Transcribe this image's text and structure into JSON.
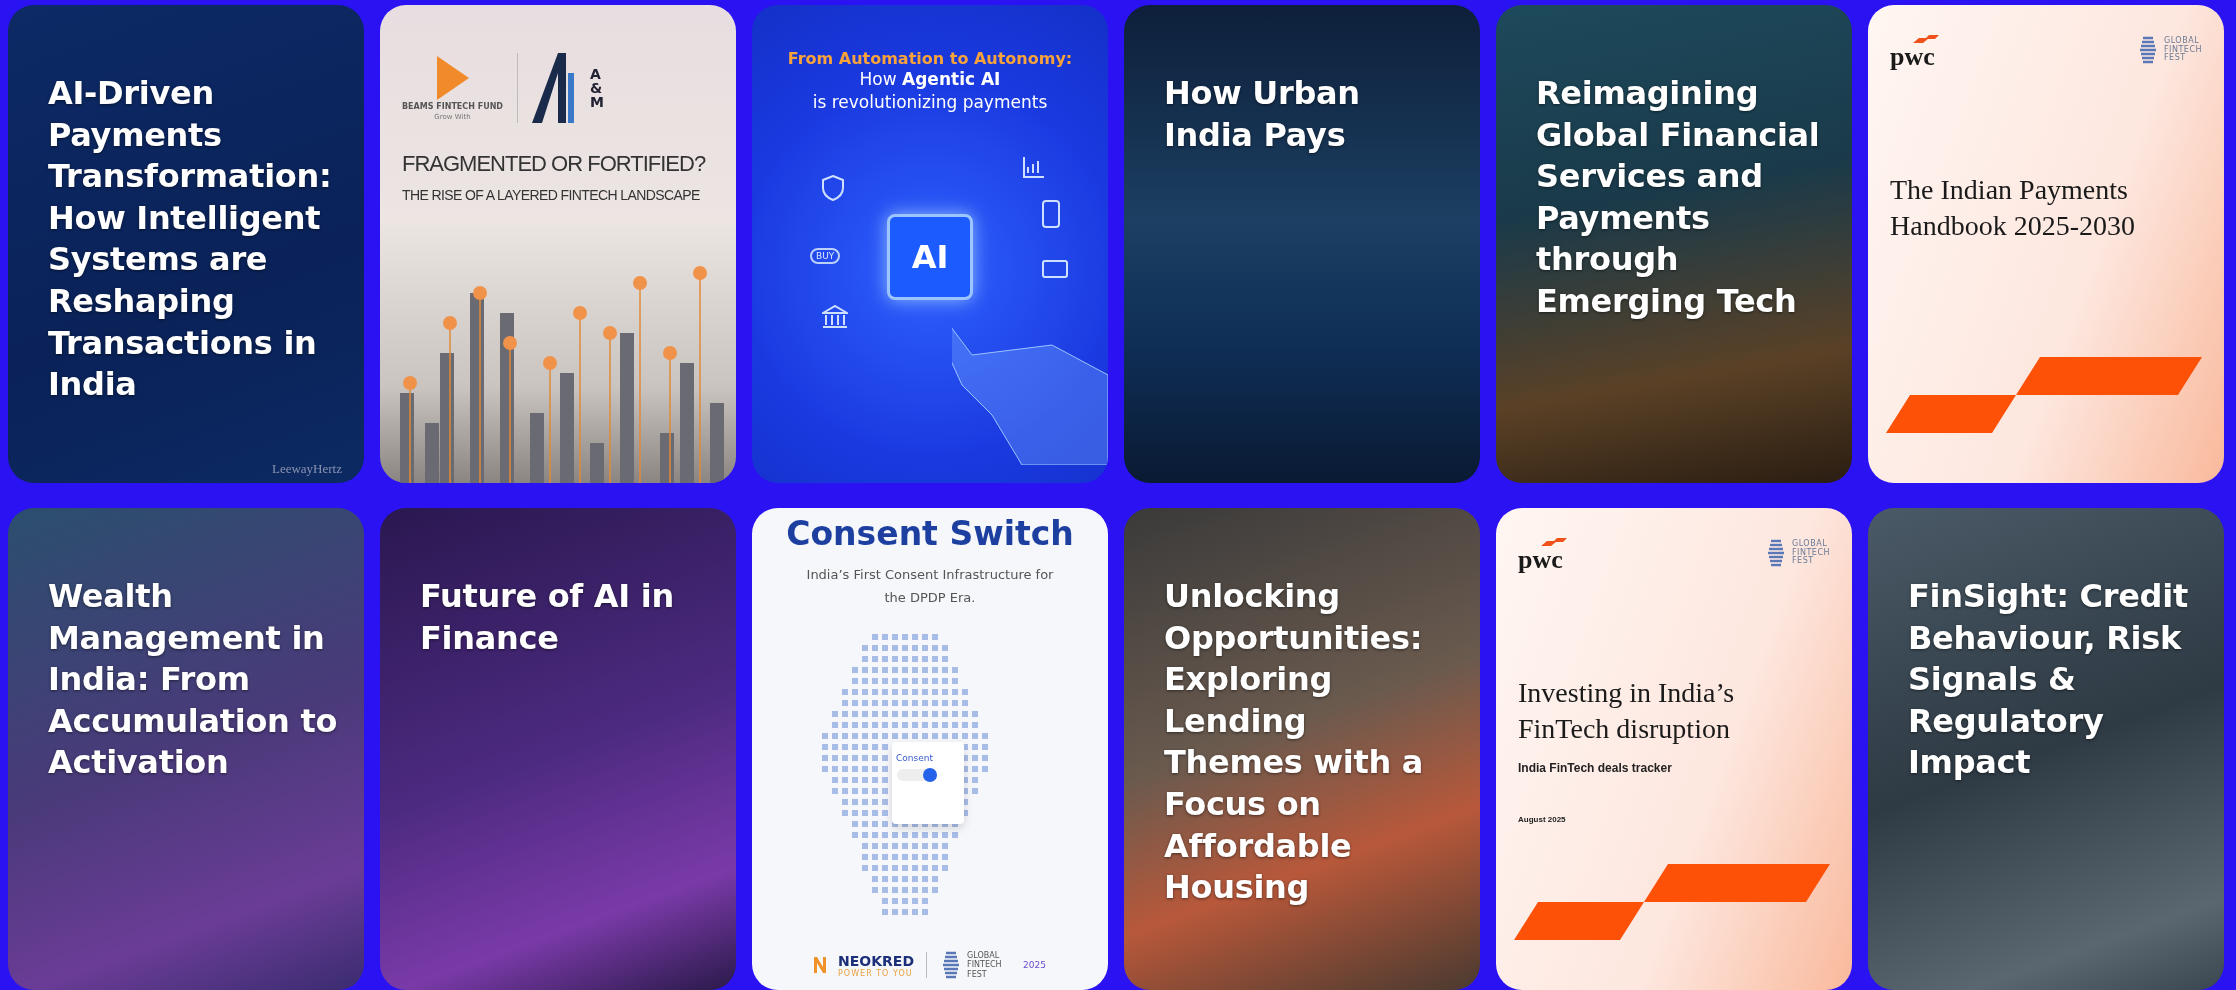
{
  "cards": [
    {
      "kind": "overlay",
      "title": "AI-Driven Payments Transformation: How Intelligent Systems are Reshaping Transactions in India",
      "credit": "LeewayHertz"
    },
    {
      "kind": "landscape",
      "fund": "BEAMS FINTECH FUND",
      "tagline": "Grow With",
      "partner": "A&M",
      "title": "FRAGMENTED OR FORTIFIED?",
      "subtitle": "THE RISE OF A LAYERED FINTECH LANDSCAPE"
    },
    {
      "kind": "agentic",
      "lead": "From Automation to Autonomy:",
      "lines": [
        "How **Agentic AI**",
        "is revolutionizing payments"
      ],
      "chip": "AI",
      "badge": "BUY"
    },
    {
      "kind": "overlay",
      "title": "How Urban India Pays"
    },
    {
      "kind": "overlay",
      "title": "Reimagining Global Financial Services and Payments through Emerging Tech"
    },
    {
      "kind": "pwc",
      "brand": "pwc",
      "partner": "GLOBAL FINTECH FEST",
      "title": "The Indian Payments Handbook 2025-2030"
    },
    {
      "kind": "overlay",
      "title": "Wealth Management in India: From Accumulation to Activation"
    },
    {
      "kind": "overlay",
      "title": "Future of AI in Finance"
    },
    {
      "kind": "consent",
      "title": "Consent Switch",
      "subtitle": "India’s First Consent Infrastructure for the DPDP Era.",
      "doc_label": "Consent",
      "brand": "NEOKRED",
      "tagline": "POWER TO YOU",
      "partner": "GLOBAL FINTECH FEST",
      "year": "2025"
    },
    {
      "kind": "overlay",
      "title": "Unlocking Opportunities: Exploring Lending Themes with a Focus on Affordable Housing"
    },
    {
      "kind": "pwc",
      "brand": "pwc",
      "partner": "GLOBAL FINTECH FEST",
      "title": "Investing in India’s FinTech disruption",
      "subtitle": "India FinTech deals tracker",
      "date": "August 2025"
    },
    {
      "kind": "overlay",
      "title": "FinSight: Credit Behaviour, Risk Signals & Regulatory Impact"
    }
  ]
}
